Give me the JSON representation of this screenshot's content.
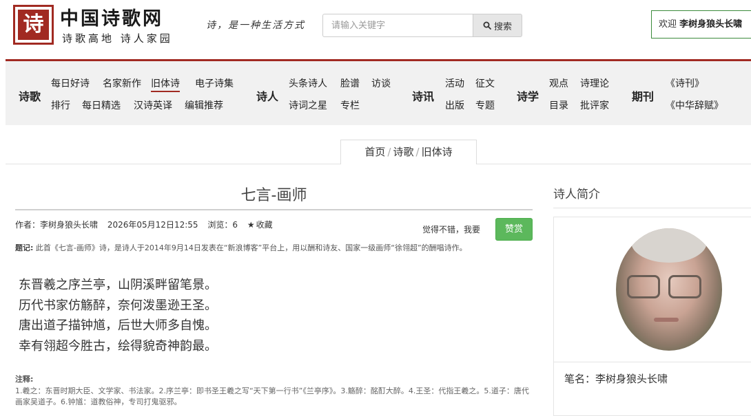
{
  "header": {
    "logo_char": "诗",
    "site_title": "中国诗歌网",
    "site_subtitle": "诗歌高地 诗人家园",
    "slogan": "诗，是一种生活方式",
    "search_placeholder": "请输入关键字",
    "search_button": "搜索",
    "welcome_prefix": "欢迎",
    "welcome_user": "李树身狼头长啸"
  },
  "nav": {
    "groups": [
      {
        "title": "诗歌",
        "links": [
          "每日好诗",
          "名家新作",
          "旧体诗",
          "电子诗集",
          "排行",
          "每日精选",
          "汉诗英译",
          "编辑推荐"
        ]
      },
      {
        "title": "诗人",
        "links": [
          "头条诗人",
          "脸谱",
          "访谈",
          "诗词之星",
          "专栏"
        ]
      },
      {
        "title": "诗讯",
        "links": [
          "活动",
          "征文",
          "出版",
          "专题"
        ]
      },
      {
        "title": "诗学",
        "links": [
          "观点",
          "诗理论",
          "目录",
          "批评家"
        ]
      },
      {
        "title": "期刊",
        "links": [
          "《诗刊》",
          "《中华辞赋》"
        ]
      }
    ],
    "active": "旧体诗"
  },
  "breadcrumb": [
    "首页",
    "诗歌",
    "旧体诗"
  ],
  "article": {
    "title": "七言-画师",
    "author_label": "作者：",
    "author": "李树身狼头长啸",
    "date": "2026年05月12日12:55",
    "views_label": "浏览：",
    "views": "6",
    "favorite": "收藏",
    "appreciate_text": "觉得不错，我要",
    "appreciate_button": "赞赏",
    "note_label": "题记:",
    "note": "此首《七言-画师》诗，是诗人于2014年9月14日发表在“新浪博客”平台上，用以酬和诗友、国家一级画师“徐翎超”的酬唱诗作。",
    "poem": [
      "东晋羲之序兰亭，山阴溪畔留笔景。",
      "历代书家仿觞醉，奈何泼墨逊王圣。",
      "唐出道子描钟馗，后世大师多自愧。",
      "幸有翎超今胜古，绘得貌奇神韵最。"
    ],
    "annotation_label": "注释:",
    "annotation": "1.羲之：东晋时期大臣、文学家、书法家。2.序兰亭：即书圣王羲之写“天下第一行书”《兰亭序》。3.觞醉：酩酊大醉。4.王圣：代指王羲之。5.道子：唐代画家吴道子。6.钟馗：道教俗神，专司打鬼驱邪。"
  },
  "sidebar": {
    "title": "诗人简介",
    "penname_label": "笔名：",
    "penname": "李树身狼头长啸"
  },
  "colors": {
    "brand_red": "#a12a22",
    "appreciate_green": "#5cb85c",
    "nav_bg": "#f1f1f1"
  }
}
